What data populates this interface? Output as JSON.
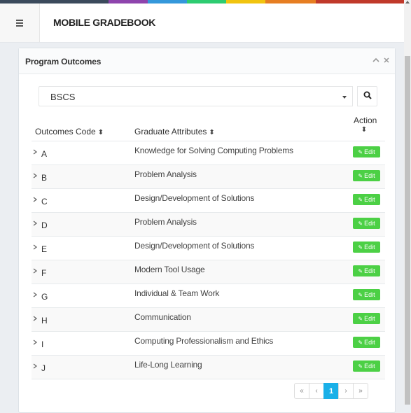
{
  "header": {
    "title": "MOBILE GRADEBOOK",
    "menu_icon": "hamburger-menu-icon",
    "strip_colors": [
      "#3b4a5c",
      "#8e44ad",
      "#3498db",
      "#2ecc71",
      "#f1c40f",
      "#e67e22",
      "#c0392b"
    ]
  },
  "panel": {
    "title": "Program Outcomes",
    "collapse_icon": "chevron-up-icon",
    "close_icon": "close-icon"
  },
  "filter": {
    "program_value": "BSCS",
    "search_icon": "search-icon"
  },
  "table": {
    "headers": {
      "code": "Outcomes Code",
      "attributes": "Graduate Attributes",
      "action": "Action"
    },
    "edit_label": "Edit",
    "rows": [
      {
        "code": "A",
        "attribute": "Knowledge for Solving Computing Problems"
      },
      {
        "code": "B",
        "attribute": "Problem Analysis"
      },
      {
        "code": "C",
        "attribute": "Design/Development of Solutions"
      },
      {
        "code": "D",
        "attribute": "Problem Analysis"
      },
      {
        "code": "E",
        "attribute": "Design/Development of Solutions"
      },
      {
        "code": "F",
        "attribute": "Modern Tool Usage"
      },
      {
        "code": "G",
        "attribute": "Individual & Team Work"
      },
      {
        "code": "H",
        "attribute": "Communication"
      },
      {
        "code": "I",
        "attribute": "Computing Professionalism and Ethics"
      },
      {
        "code": "J",
        "attribute": "Life-Long Learning"
      }
    ]
  },
  "pagination": {
    "first": "«",
    "prev": "‹",
    "current": "1",
    "next": "›",
    "last": "»"
  },
  "colors": {
    "accent_green": "#4cd045",
    "active_page": "#1ab0e8"
  }
}
